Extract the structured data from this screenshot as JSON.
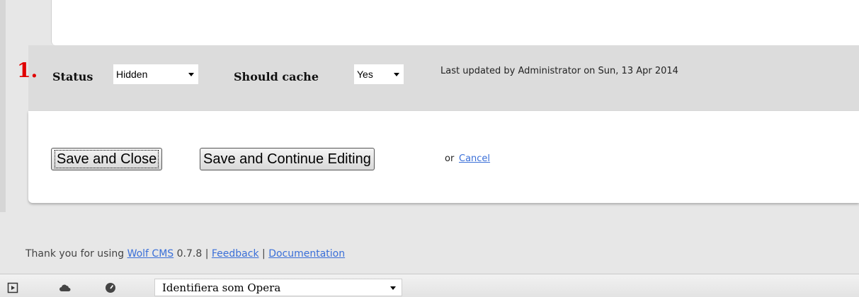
{
  "form": {
    "marker": "1.",
    "status_label": "Status",
    "status_value": "Hidden",
    "cache_label": "Should cache",
    "cache_value": "Yes",
    "last_updated": "Last updated by Administrator on Sun, 13 Apr 2014"
  },
  "actions": {
    "save_close": "Save and Close",
    "save_continue": "Save and Continue Editing",
    "or": "or",
    "cancel": "Cancel"
  },
  "footer": {
    "thanks": "Thank you for using",
    "product_link": "Wolf CMS",
    "version": "0.7.8",
    "sep": "|",
    "feedback": "Feedback",
    "documentation": "Documentation"
  },
  "statusbar": {
    "icons": [
      "panel-toggle-icon",
      "cloud-icon",
      "speed-dial-icon"
    ],
    "identify_as": "Identifiera som Opera"
  },
  "colors": {
    "marker": "#e00000",
    "link": "#3a6fd8"
  }
}
